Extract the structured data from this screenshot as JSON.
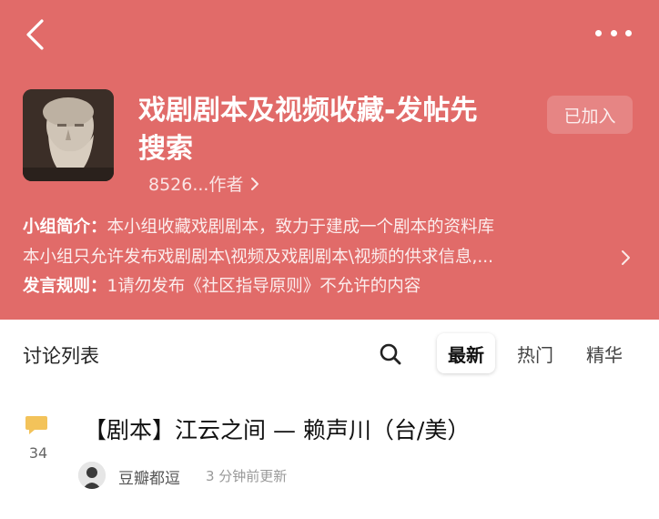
{
  "header": {
    "bg_color": "#e16b69",
    "back_icon": "chevron-left-icon",
    "more_icon": "more-dots-icon"
  },
  "group": {
    "title_line1": "戏剧剧本及视频收藏-发帖先",
    "title_line2": "搜索",
    "join_label": "已加入",
    "members_text": "8526...作者",
    "intro_label": "小组简介：",
    "intro_text": "本小组收藏戏剧剧本，致力于建成一个剧本的资料库",
    "intro_line2": "本小组只允许发布戏剧剧本\\视频及戏剧剧本\\视频的供求信息,...",
    "rules_label": "发言规则：",
    "rules_text": "1请勿发布《社区指导原则》不允许的内容"
  },
  "discussion": {
    "title": "讨论列表",
    "search_icon": "search-icon",
    "sort_tabs": [
      {
        "label": "最新",
        "active": true
      },
      {
        "label": "热门",
        "active": false
      },
      {
        "label": "精华",
        "active": false
      }
    ]
  },
  "posts": [
    {
      "title": "【剧本】江云之间 — 赖声川（台/美）",
      "comment_count": "34",
      "author": "豆瓣都逗",
      "time": "3 分钟前更新"
    }
  ]
}
